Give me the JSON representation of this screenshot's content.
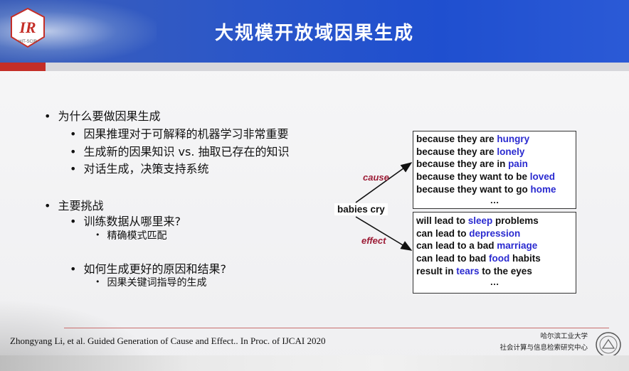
{
  "header": {
    "title": "大规模开放域因果生成",
    "logo_text": "HIT-SCIR"
  },
  "bullets": {
    "q1": "为什么要做因果生成",
    "q1_sub": [
      "因果推理对于可解释的机器学习非常重要",
      "生成新的因果知识 vs. 抽取已存在的知识",
      "对话生成，决策支持系统"
    ],
    "q2": "主要挑战",
    "q2_sub1": "训练数据从哪里来?",
    "q2_sub1_sub": "精确模式匹配",
    "q2_sub2": "如何生成更好的原因和结果?",
    "q2_sub2_sub": "因果关键词指导的生成"
  },
  "diagram": {
    "source": "babies cry",
    "cause_label": "cause",
    "effect_label": "effect",
    "cause_lines": [
      {
        "pre": "because they are ",
        "kw": "hungry",
        "post": ""
      },
      {
        "pre": "because they are ",
        "kw": "lonely",
        "post": ""
      },
      {
        "pre": "because they are in ",
        "kw": "pain",
        "post": ""
      },
      {
        "pre": "because they want to be ",
        "kw": "loved",
        "post": ""
      },
      {
        "pre": "because they want to go ",
        "kw": "home",
        "post": ""
      }
    ],
    "effect_lines": [
      {
        "pre": "will lead to ",
        "kw": "sleep",
        "post": " problems"
      },
      {
        "pre": "can lead to ",
        "kw": "depression",
        "post": ""
      },
      {
        "pre": "can lead to a bad ",
        "kw": "marriage",
        "post": ""
      },
      {
        "pre": "can lead to bad ",
        "kw": "food",
        "post": " habits"
      },
      {
        "pre": "result in ",
        "kw": "tears",
        "post": " to the eyes"
      }
    ],
    "ellipsis": "…"
  },
  "footer": {
    "citation": "Zhongyang Li, et al. Guided Generation of Cause and Effect.. In Proc. of IJCAI 2020",
    "org_line1": "哈尔滨工业大学",
    "org_line2": "社会计算与信息检索研究中心"
  },
  "colors": {
    "header_blue": "#2a56c9",
    "accent_red": "#c42e27",
    "keyword_blue": "#2a2ad0",
    "arrow_label": "#9c1b35"
  }
}
